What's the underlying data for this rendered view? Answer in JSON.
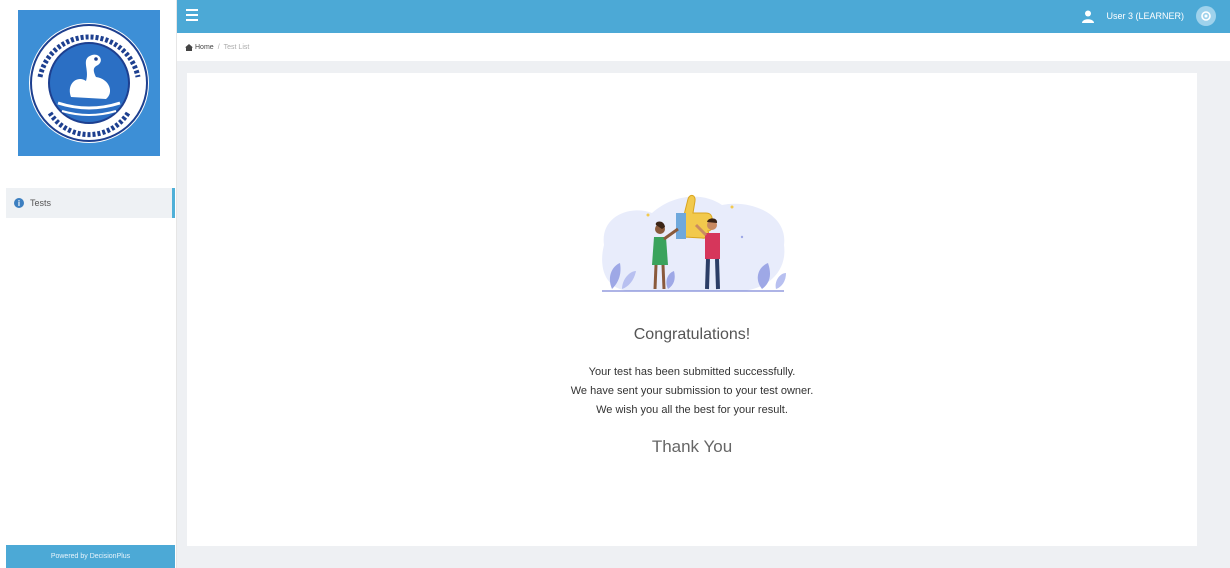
{
  "sidebar": {
    "nav_items": [
      {
        "label": "Tests",
        "icon": "info-circle-icon"
      }
    ],
    "powered_by": "Powered by DecisionPlus"
  },
  "topbar": {
    "user_label": "User 3 (LEARNER)",
    "accent_color": "#4ca9d6"
  },
  "breadcrumb": {
    "home": "Home",
    "current": "Test List"
  },
  "main": {
    "heading": "Congratulations!",
    "lines": [
      "Your test has been submitted successfully.",
      "We have sent your submission to your test owner.",
      "We wish you all the best for your result."
    ],
    "thanks": "Thank You"
  }
}
